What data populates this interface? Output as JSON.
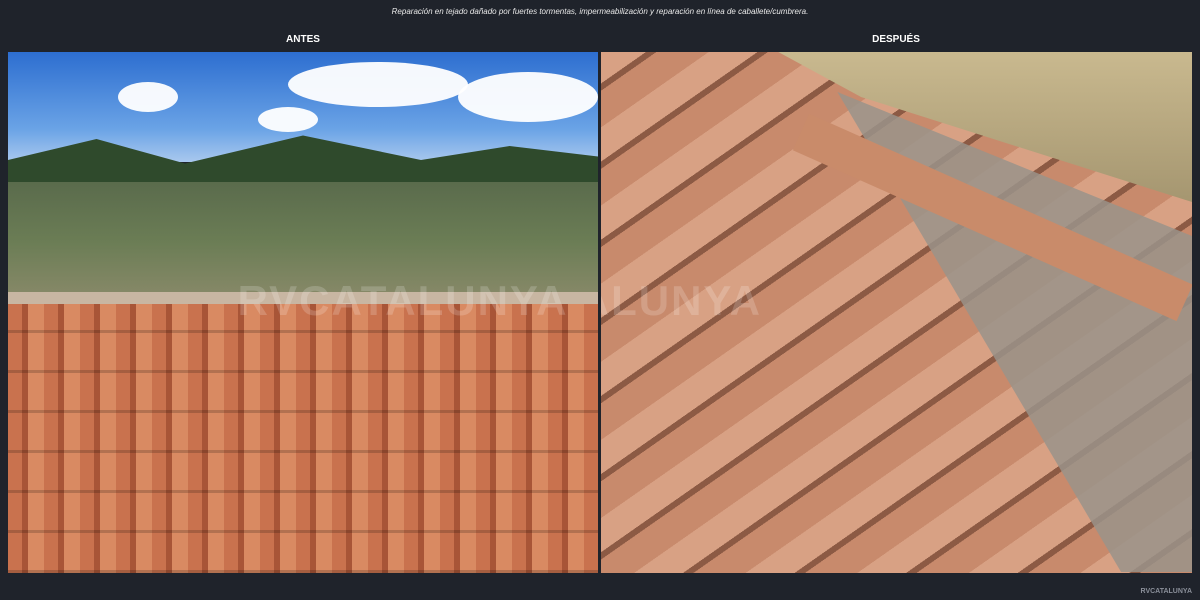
{
  "caption": "Reparación en tejado dañado por fuertes tormentas, impermeabilización y reparación en línea de caballete/cumbrera.",
  "before": {
    "label": "ANTES"
  },
  "after": {
    "label": "DESPUÉS"
  },
  "watermark": "RVCATALUNYA",
  "brand": "RVCATALUNYA"
}
